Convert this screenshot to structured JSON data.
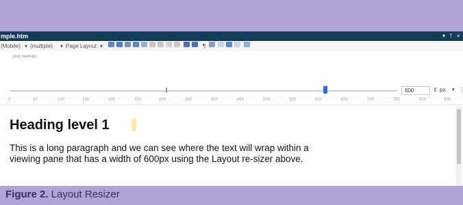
{
  "window": {
    "file_name": "mple.htm",
    "pin_icon": "pin-icon",
    "close_icon": "close-icon"
  },
  "toolbar": {
    "device": "(Mobile)",
    "mode": "(multiple)",
    "page_layout": "Page Layout",
    "hint": "(text markup)"
  },
  "resizer": {
    "width_value": "600",
    "unit": "px",
    "unit_arrow": "▾",
    "more": "⋮"
  },
  "ruler": {
    "ticks": [
      "0",
      "50",
      "100",
      "150",
      "200",
      "250",
      "300",
      "350",
      "400",
      "450",
      "500",
      "550",
      "600",
      "650",
      "700",
      "750",
      "800",
      "850"
    ]
  },
  "content": {
    "heading": "Heading level 1",
    "paragraph": "This is a long paragraph and we can see where the text will wrap within a viewing pane that has a width of 600px using the Layout re-sizer above."
  },
  "caption": {
    "label": "Figure 2.",
    "text": " Layout Resizer"
  },
  "colors": {
    "background": "#b2a4d2",
    "titlebar": "#123c58",
    "caption_text": "#3a2b67",
    "thumb": "#2e6dd1"
  }
}
